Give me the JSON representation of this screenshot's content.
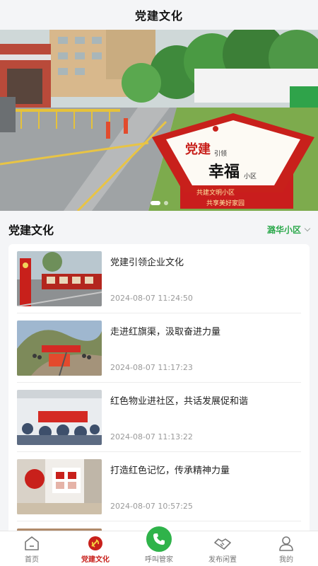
{
  "header": {
    "title": "党建文化"
  },
  "banner": {
    "sign_top": "党建",
    "sign_sub1": "引领",
    "sign_main": "幸福",
    "sign_sub2": "小区",
    "base_line1": "共建文明小区",
    "base_line2": "共享美好家园",
    "slides": 2,
    "active_slide": 0
  },
  "section": {
    "title": "党建文化",
    "community": "潞华小区"
  },
  "articles": [
    {
      "title": "党建引领企业文化",
      "time": "2024-08-07 11:24:50"
    },
    {
      "title": "走进红旗渠，汲取奋进力量",
      "time": "2024-08-07 11:17:23"
    },
    {
      "title": "红色物业进社区，共话发展促和谐",
      "time": "2024-08-07 11:13:22"
    },
    {
      "title": "打造红色记忆，传承精神力量",
      "time": "2024-08-07 10:57:25"
    }
  ],
  "tabbar": {
    "home": "首页",
    "party": "党建文化",
    "call": "呼叫管家",
    "idle": "发布闲置",
    "mine": "我的"
  },
  "colors": {
    "accent_red": "#c8201b",
    "accent_green": "#2fb34a"
  }
}
